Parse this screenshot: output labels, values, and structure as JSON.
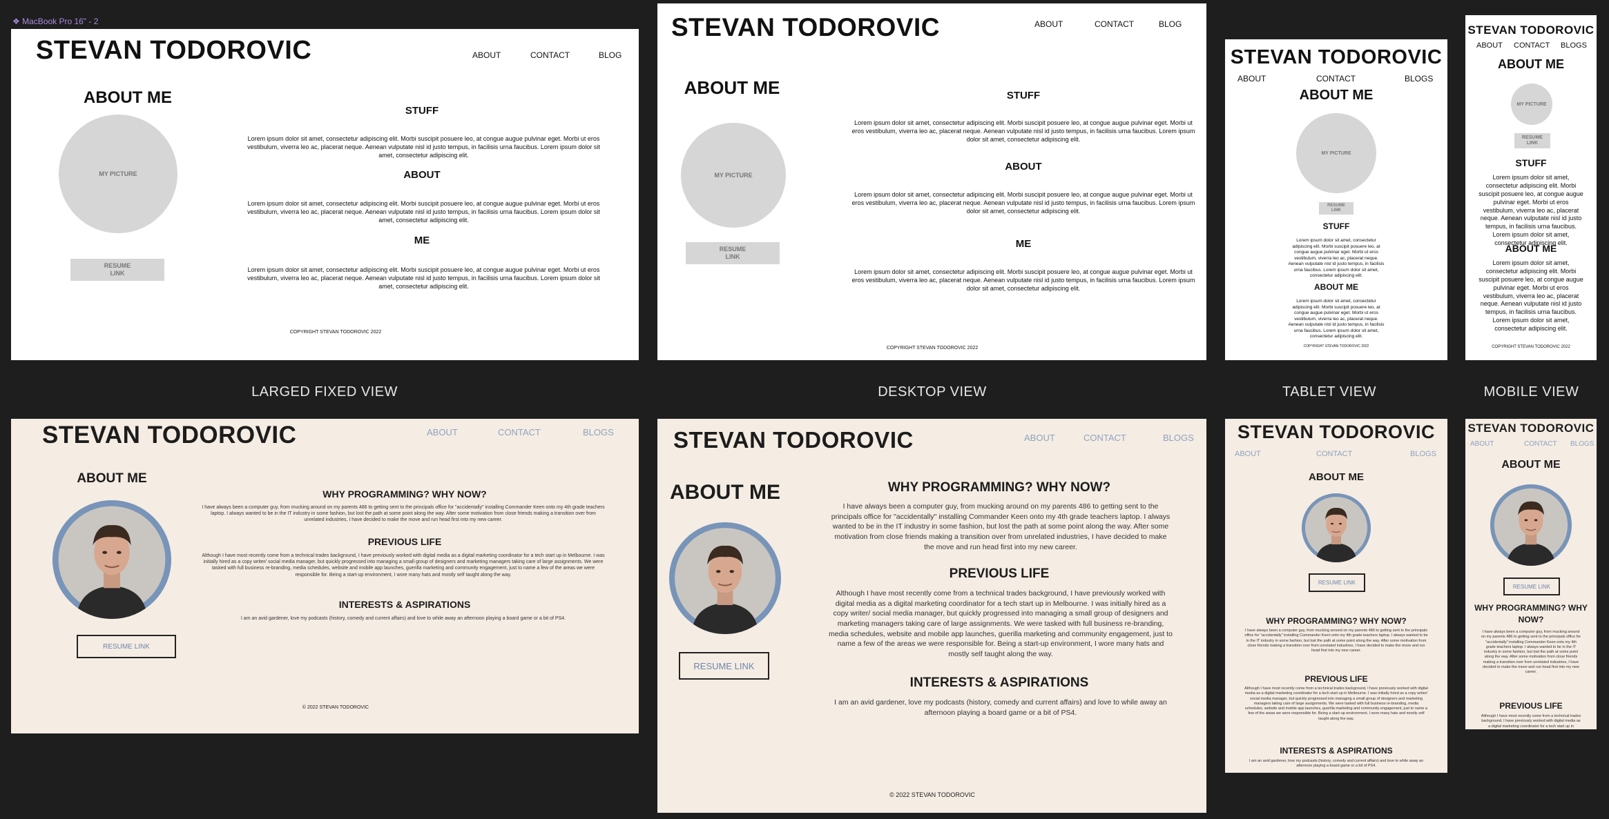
{
  "canvas": {
    "frame_label": "MacBook Pro 16\" - 2"
  },
  "captions": {
    "large": "LARGED FIXED VIEW",
    "desktop": "DESKTOP VIEW",
    "tablet": "TABLET VIEW",
    "mobile": "MOBILE VIEW"
  },
  "site": {
    "name": "STEVAN TODOROVIC",
    "nav": {
      "about": "ABOUT",
      "contact": "CONTACT",
      "blog": "BLOG",
      "blogs": "BLOGS"
    }
  },
  "wireframe": {
    "about_me": "ABOUT ME",
    "picture": "MY PICTURE",
    "resume": "RESUME LINK",
    "stuff": "STUFF",
    "about": "ABOUT",
    "me": "ME",
    "lorem": "Lorem ipsum dolor sit amet, consectetur adipiscing elit. Morbi suscipit posuere leo, at congue augue pulvinar eget. Morbi ut eros vestibulum, viverra leo ac, placerat neque. Aenean vulputate nisl id justo tempus, in facilisis urna faucibus. Lorem ipsum dolor sit amet, consectetur adipiscing elit.",
    "copyright": "COPYRIGHT STEVAN TODOROVIC 2022"
  },
  "final": {
    "about_me": "ABOUT ME",
    "resume": "RESUME LINK",
    "why_heading": "WHY PROGRAMMING? WHY NOW?",
    "why_text": "I have always been a computer guy, from mucking around on my parents 486 to getting sent to the principals office for \"accidentally\" installing Commander Keen onto my 4th grade teachers laptop. I always wanted to be in the IT industry in some fashion, but lost the path at some point along the way. After some motivation from close friends making a transition over from unrelated industries, I have decided to make the move and run head first into my new career.",
    "prev_heading": "PREVIOUS LIFE",
    "prev_text": "Although I have most recently come from a technical trades background, I have previously worked with digital media as a digital marketing coordinator for a tech start up in Melbourne. I was initially hired as a copy writer/ social media manager, but quickly progressed into managing a small group of designers and marketing managers taking care of large assignments. We were tasked with full business re-branding, media schedules, website and mobile app launches, guerilla marketing and community engagement, just to name a few of the areas we were responsible for. Being a start-up environment, I wore many hats and mostly self taught along the way.",
    "int_heading": "INTERESTS & ASPIRATIONS",
    "int_text": "I am an avid gardener, love my podcasts (history, comedy and current affairs) and love to while away an afternoon playing a board game or a bit of PS4.",
    "copyright": "© 2022 STEVAN TODOROVIC"
  },
  "colors": {
    "canvas": "#1e1e1e",
    "wireframe_bg": "#ffffff",
    "final_bg": "#f5ece3",
    "nav_link": "#8ea4c0",
    "photo_ring": "#7894b8",
    "placeholder": "#d6d6d6"
  }
}
